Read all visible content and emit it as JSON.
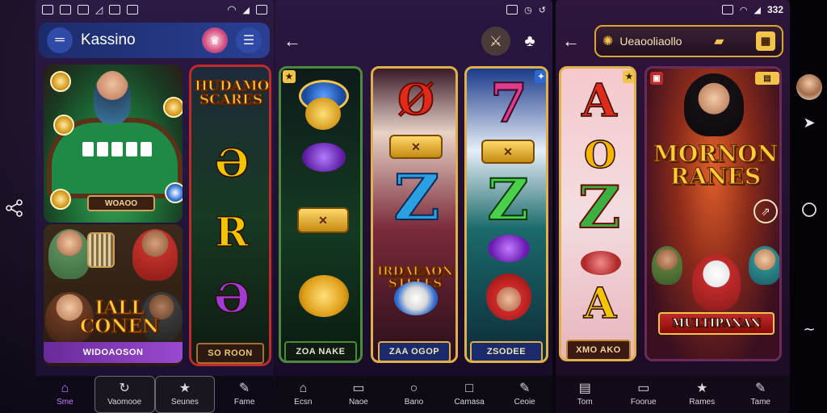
{
  "status_bar": {
    "right_time": "332"
  },
  "screen1": {
    "app_title": "Kassino",
    "menu_icon": "hamburger-icon",
    "profile_icon": "avatar-icon",
    "card_table": {
      "sign": "WOAOO"
    },
    "card_slots_title": "HUDAMONI\nSCARES",
    "card_slots_symbols": [
      "Ə",
      "R",
      "Ə"
    ],
    "card_slots_footer": "SO ROON",
    "card_bottom_title": "IALL\nCONEN",
    "card_bottom_footer": "WIDOAOSON",
    "nav": [
      {
        "label": "Sme",
        "icon": "home-icon"
      },
      {
        "label": "Vaomooe",
        "icon": "refresh-icon"
      },
      {
        "label": "Seunes",
        "icon": "star-icon"
      },
      {
        "label": "Fame",
        "icon": "person-icon"
      }
    ]
  },
  "screen2": {
    "reels": [
      {
        "footer": "ZOA NAKE",
        "symbols": [
          "●",
          "●",
          "✕",
          "●"
        ]
      },
      {
        "footer": "ZAA OGOP",
        "symbols": [
          "Ø",
          "✕",
          "Z",
          "IRDAEAON\nSTELES"
        ]
      },
      {
        "footer": "ZSODEE",
        "symbols": [
          "7",
          "✕",
          "Z",
          "●"
        ]
      }
    ],
    "nav": [
      {
        "label": "Ecsn",
        "icon": "home-outline-icon"
      },
      {
        "label": "Naoe",
        "icon": "chat-icon"
      },
      {
        "label": "Bano",
        "icon": "circle-icon"
      },
      {
        "label": "Camasa",
        "icon": "square-icon"
      },
      {
        "label": "Ceoie",
        "icon": "pen-icon"
      }
    ]
  },
  "screen3": {
    "title": "Ueaooliaollo",
    "reel_footer": "XMO AKO",
    "reel_symbols": [
      "A",
      "O",
      "Z",
      "●",
      "A"
    ],
    "banner_title": "MORNON\nRANES",
    "banner_sub": "MULTIPANAN",
    "nav": [
      {
        "label": "Tom",
        "icon": "home-box-icon"
      },
      {
        "label": "Foorue",
        "icon": "chat-icon"
      },
      {
        "label": "Rames",
        "icon": "star-icon"
      },
      {
        "label": "Tame",
        "icon": "pen-icon"
      }
    ]
  },
  "colors": {
    "accent_purple": "#8e3bd1",
    "gold": "#d9a733",
    "nav_active": "#c77bff"
  }
}
